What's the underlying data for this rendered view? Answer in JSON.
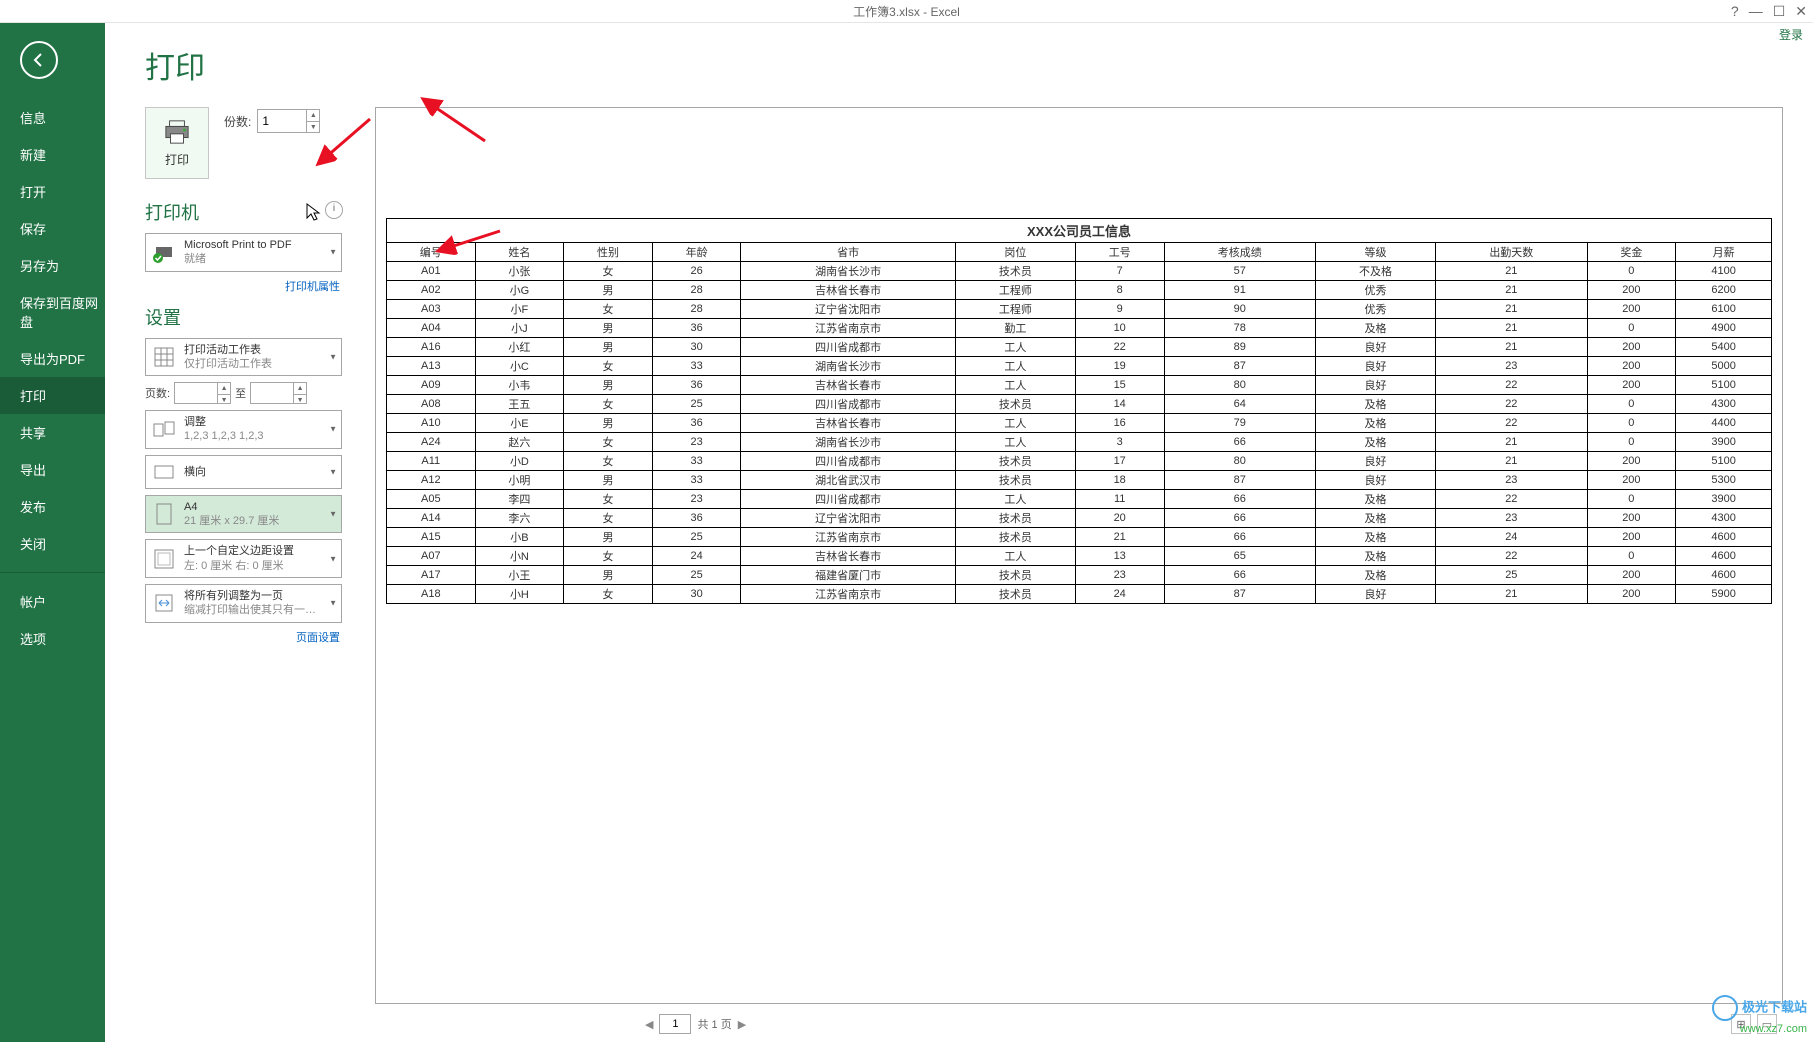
{
  "titlebar": {
    "filename": "工作簿3.xlsx - Excel",
    "help": "?",
    "min": "—",
    "max": "☐",
    "close": "✕",
    "login": "登录"
  },
  "sidebar": {
    "items": [
      "信息",
      "新建",
      "打开",
      "保存",
      "另存为",
      "保存到百度网盘",
      "导出为PDF",
      "打印",
      "共享",
      "导出",
      "发布",
      "关闭"
    ],
    "items2": [
      "帐户",
      "选项"
    ],
    "active_index": 7
  },
  "page": {
    "title": "打印"
  },
  "print_btn": {
    "label": "打印"
  },
  "copies": {
    "label": "份数:",
    "value": "1"
  },
  "printer_section": {
    "title": "打印机",
    "info": "ⓘ"
  },
  "printer_dd": {
    "name": "Microsoft Print to PDF",
    "status": "就绪"
  },
  "printer_props_link": "打印机属性",
  "settings_section": {
    "title": "设置"
  },
  "dd_active": {
    "line1": "打印活动工作表",
    "line2": "仅打印活动工作表"
  },
  "pages": {
    "label": "页数:",
    "to": "至"
  },
  "dd_collate": {
    "line1": "调整",
    "line2": "1,2,3   1,2,3   1,2,3"
  },
  "dd_orient": {
    "line1": "横向",
    "line2": ""
  },
  "dd_paper": {
    "line1": "A4",
    "line2": "21 厘米 x 29.7 厘米"
  },
  "dd_margin": {
    "line1": "上一个自定义边距设置",
    "line2": "左: 0 厘米   右: 0 厘米"
  },
  "dd_fit": {
    "line1": "将所有列调整为一页",
    "line2": "缩减打印输出使其只有一…"
  },
  "page_setup_link": "页面设置",
  "pager": {
    "prev": "◀",
    "next": "▶",
    "current": "1",
    "total_label": "共 1 页"
  },
  "preview": {
    "title": "XXX公司员工信息",
    "headers": [
      "编号",
      "姓名",
      "性别",
      "年龄",
      "省市",
      "岗位",
      "工号",
      "考核成绩",
      "等级",
      "出勤天数",
      "奖金",
      "月薪"
    ],
    "rows": [
      [
        "A01",
        "小张",
        "女",
        "26",
        "湖南省长沙市",
        "技术员",
        "7",
        "57",
        "不及格",
        "21",
        "0",
        "4100"
      ],
      [
        "A02",
        "小G",
        "男",
        "28",
        "吉林省长春市",
        "工程师",
        "8",
        "91",
        "优秀",
        "21",
        "200",
        "6200"
      ],
      [
        "A03",
        "小F",
        "女",
        "28",
        "辽宁省沈阳市",
        "工程师",
        "9",
        "90",
        "优秀",
        "21",
        "200",
        "6100"
      ],
      [
        "A04",
        "小J",
        "男",
        "36",
        "江苏省南京市",
        "勤工",
        "10",
        "78",
        "及格",
        "21",
        "0",
        "4900"
      ],
      [
        "A16",
        "小红",
        "男",
        "30",
        "四川省成都市",
        "工人",
        "22",
        "89",
        "良好",
        "21",
        "200",
        "5400"
      ],
      [
        "A13",
        "小C",
        "女",
        "33",
        "湖南省长沙市",
        "工人",
        "19",
        "87",
        "良好",
        "23",
        "200",
        "5000"
      ],
      [
        "A09",
        "小韦",
        "男",
        "36",
        "吉林省长春市",
        "工人",
        "15",
        "80",
        "良好",
        "22",
        "200",
        "5100"
      ],
      [
        "A08",
        "王五",
        "女",
        "25",
        "四川省成都市",
        "技术员",
        "14",
        "64",
        "及格",
        "22",
        "0",
        "4300"
      ],
      [
        "A10",
        "小E",
        "男",
        "36",
        "吉林省长春市",
        "工人",
        "16",
        "79",
        "及格",
        "22",
        "0",
        "4400"
      ],
      [
        "A24",
        "赵六",
        "女",
        "23",
        "湖南省长沙市",
        "工人",
        "3",
        "66",
        "及格",
        "21",
        "0",
        "3900"
      ],
      [
        "A11",
        "小D",
        "女",
        "33",
        "四川省成都市",
        "技术员",
        "17",
        "80",
        "良好",
        "21",
        "200",
        "5100"
      ],
      [
        "A12",
        "小明",
        "男",
        "33",
        "湖北省武汉市",
        "技术员",
        "18",
        "87",
        "良好",
        "23",
        "200",
        "5300"
      ],
      [
        "A05",
        "李四",
        "女",
        "23",
        "四川省成都市",
        "工人",
        "11",
        "66",
        "及格",
        "22",
        "0",
        "3900"
      ],
      [
        "A14",
        "李六",
        "女",
        "36",
        "辽宁省沈阳市",
        "技术员",
        "20",
        "66",
        "及格",
        "23",
        "200",
        "4300"
      ],
      [
        "A15",
        "小B",
        "男",
        "25",
        "江苏省南京市",
        "技术员",
        "21",
        "66",
        "及格",
        "24",
        "200",
        "4600"
      ],
      [
        "A07",
        "小N",
        "女",
        "24",
        "吉林省长春市",
        "工人",
        "13",
        "65",
        "及格",
        "22",
        "0",
        "4600"
      ],
      [
        "A17",
        "小王",
        "男",
        "25",
        "福建省厦门市",
        "技术员",
        "23",
        "66",
        "及格",
        "25",
        "200",
        "4600"
      ],
      [
        "A18",
        "小H",
        "女",
        "30",
        "江苏省南京市",
        "技术员",
        "24",
        "87",
        "良好",
        "21",
        "200",
        "5900"
      ]
    ]
  },
  "watermark": {
    "line1": "极光下载站",
    "line2": "www.xz7.com"
  }
}
